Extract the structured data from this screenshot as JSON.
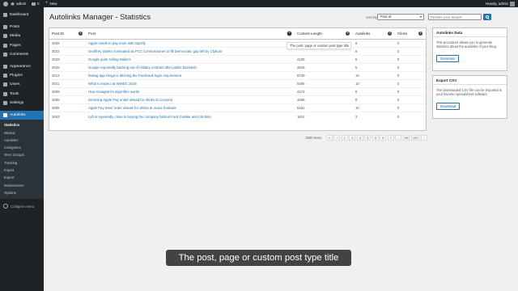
{
  "admin_bar": {
    "site_name": "admin",
    "comments_count": "0",
    "new_label": "New",
    "greeting": "Howdy, admin"
  },
  "sidebar": {
    "items": [
      {
        "label": "Dashboard",
        "icon": "dashboard-icon"
      },
      {
        "label": "Posts",
        "icon": "pin-icon"
      },
      {
        "label": "Media",
        "icon": "media-icon"
      },
      {
        "label": "Pages",
        "icon": "page-icon"
      },
      {
        "label": "Comments",
        "icon": "comment-icon"
      },
      {
        "label": "Appearance",
        "icon": "brush-icon"
      },
      {
        "label": "Plugins",
        "icon": "plug-icon"
      },
      {
        "label": "Users",
        "icon": "user-icon"
      },
      {
        "label": "Tools",
        "icon": "wrench-icon"
      },
      {
        "label": "Settings",
        "icon": "settings-icon"
      },
      {
        "label": "Autolinks",
        "icon": "link-icon"
      }
    ],
    "submenu": [
      "Statistics",
      "Wizard",
      "Autolinks",
      "Categories",
      "Term Groups",
      "Tracking",
      "Import",
      "Export",
      "Maintenance",
      "Options"
    ],
    "collapse_label": "Collapse menu"
  },
  "page_title": "Autolinks Manager - Statistics",
  "toolbar": {
    "sort_label": "Sort By",
    "sort_value": "Post Id",
    "search_placeholder": "Perform your Search"
  },
  "table": {
    "headers": [
      "Post ID",
      "Post",
      "Content Length",
      "Autolinks",
      "Clicks"
    ],
    "rows": [
      [
        "3025",
        "Apple needs to pay more with Spotify",
        "",
        "6",
        "0"
      ],
      [
        "3022",
        "Geoffrey Starks nominated as FCC Commissioner to fill Democratic gap left by Clyburn",
        "",
        "5",
        "0"
      ],
      [
        "3019",
        "Google quits selling Nokia's",
        "4106",
        "6",
        "0"
      ],
      [
        "3016",
        "Google reportedly backing out of military contract after public backlash",
        "2816",
        "5",
        "0"
      ],
      [
        "3013",
        "Dating app Hinge is ditching the Facebook login requirement",
        "8739",
        "16",
        "0"
      ],
      [
        "3011",
        "What to expect at WWDC 2018",
        "5455",
        "10",
        "0"
      ],
      [
        "3009",
        "How Instagram's algorithm works",
        "4174",
        "8",
        "0"
      ],
      [
        "3006",
        "Demoing Apple Pay under ahead for drinks at concerts",
        "4598",
        "8",
        "0"
      ],
      [
        "3005",
        "Apple Pay tests 'order ahead' for drinks at music festivals",
        "5161",
        "10",
        "0"
      ],
      [
        "3003",
        "Lyft is reportedly close to buying the company behind Ford GoBike and Citi Bike",
        "1812",
        "3",
        "0"
      ]
    ]
  },
  "tooltip": "The post, page or custom post type title",
  "pagination": {
    "items_count": "3080 items",
    "pages": [
      "«",
      "‹",
      "1",
      "2",
      "3",
      "4",
      "5",
      "6",
      "7",
      "...",
      "99",
      "100",
      "›"
    ]
  },
  "boxes": {
    "data": {
      "title": "Autolinks Data",
      "description": "This procedure allows you to generate statistics about the autolinks of your blog.",
      "button": "Generate"
    },
    "export": {
      "title": "Export CSV",
      "description": "The downloaded CSV file can be imported in your favorite spreadsheet software.",
      "button": "Download"
    }
  },
  "caption": "The post, page or custom post type title",
  "colors": {
    "accent": "#2271b1",
    "sidebar_bg": "#1d2327",
    "page_bg": "#f0f0f1"
  }
}
